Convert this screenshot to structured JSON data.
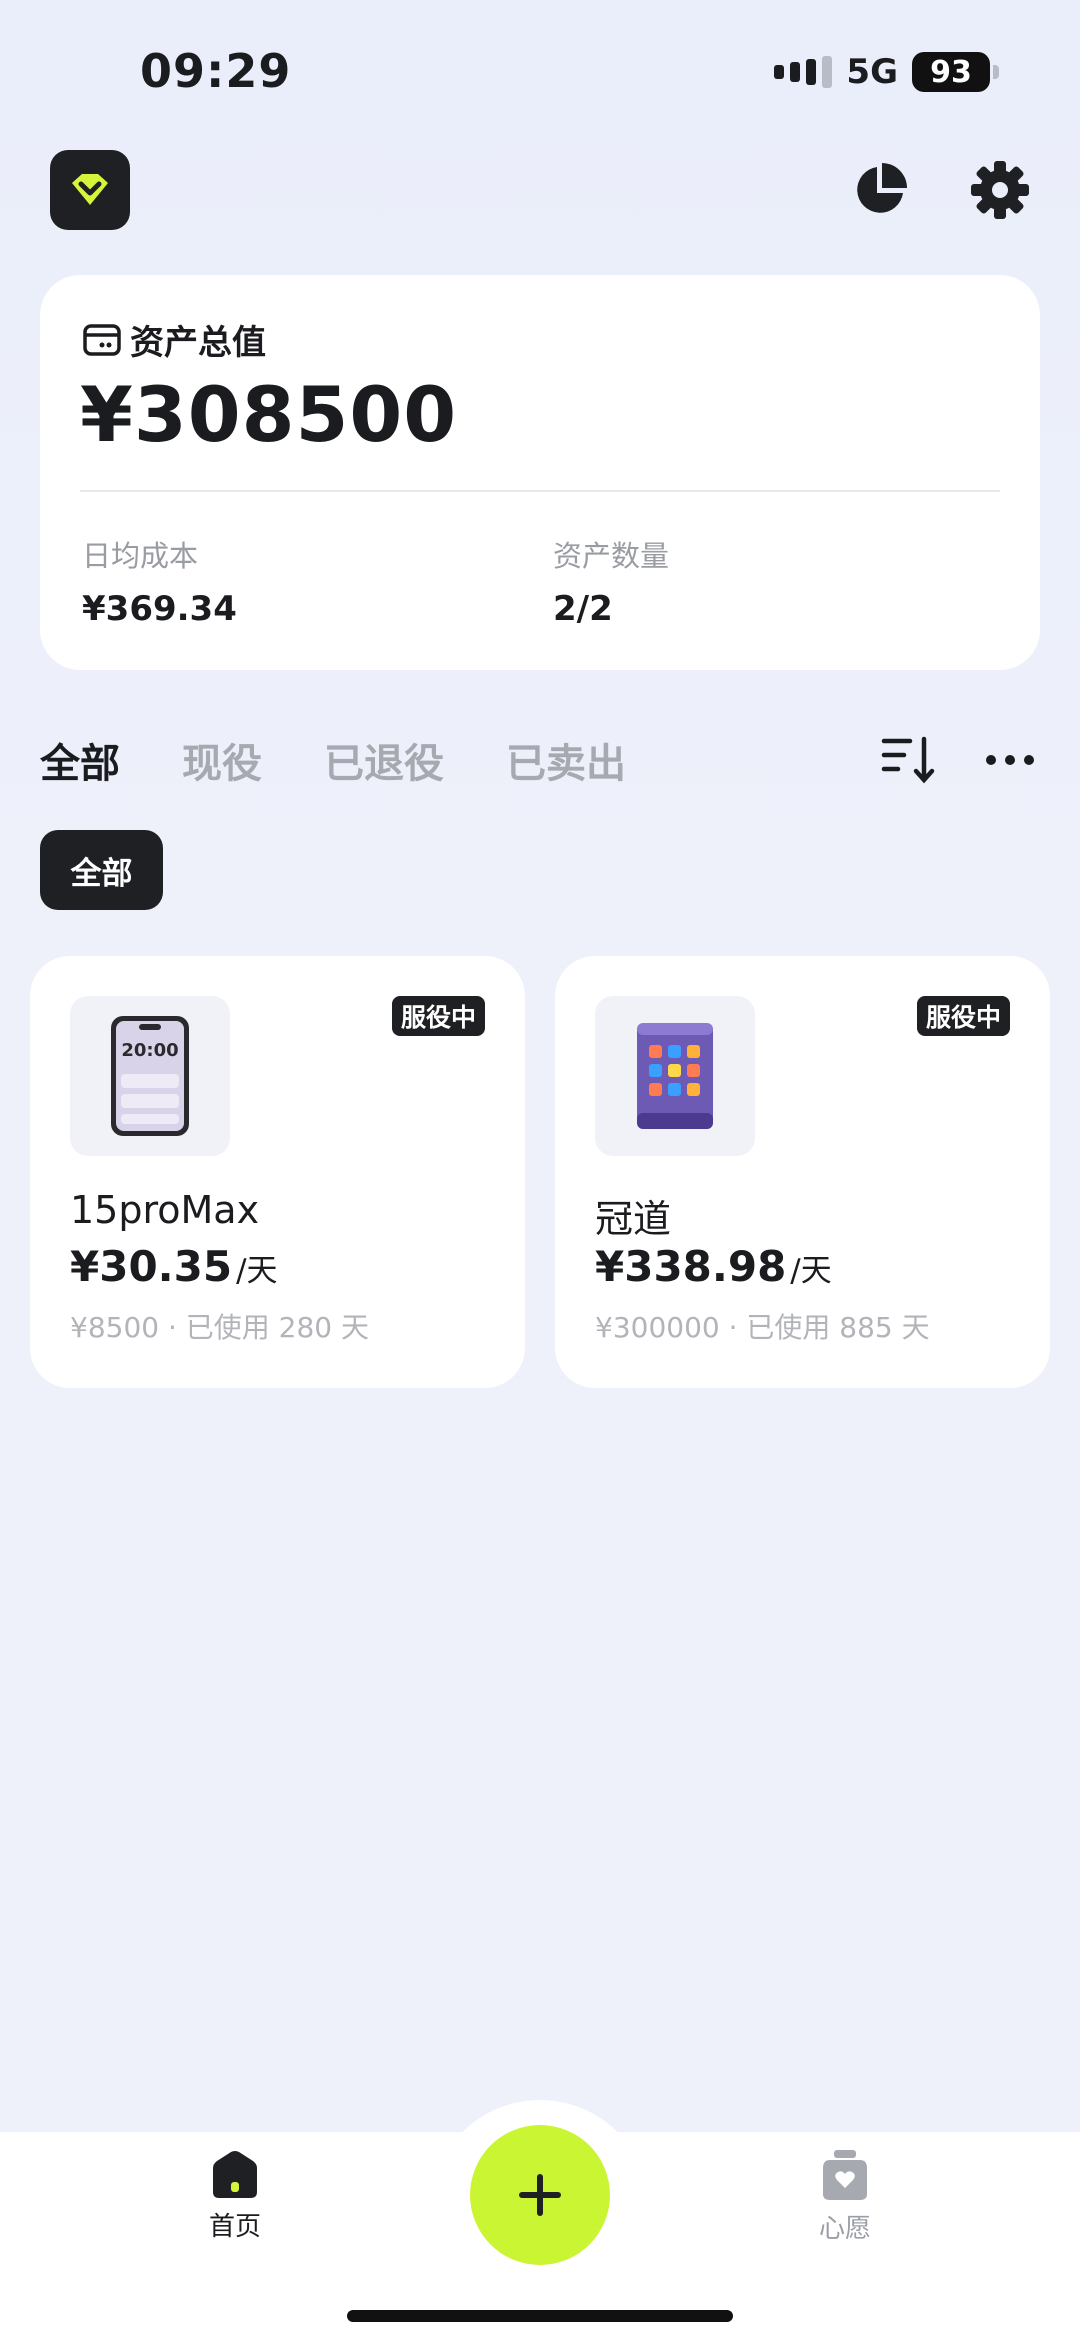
{
  "status_bar": {
    "time": "09:29",
    "network": "5G",
    "battery": "93"
  },
  "header": {
    "logo_icon": "gem-icon",
    "chart_icon": "pie-chart-icon",
    "settings_icon": "gear-icon",
    "accent_color": "#d6f53a"
  },
  "summary": {
    "label": "资产总值",
    "total": "¥308500",
    "daily_cost_label": "日均成本",
    "daily_cost_value": "¥369.34",
    "asset_count_label": "资产数量",
    "asset_count_value": "2/2"
  },
  "tabs": [
    {
      "label": "全部",
      "active": true
    },
    {
      "label": "现役",
      "active": false
    },
    {
      "label": "已退役",
      "active": false
    },
    {
      "label": "已卖出",
      "active": false
    }
  ],
  "filter_chip": "全部",
  "assets": [
    {
      "name": "15proMax",
      "status": "服役中",
      "daily_price": "¥30.35",
      "unit": "/天",
      "meta": "¥8500 · 已使用 280 天",
      "icon": "phone-icon",
      "phone_time": "20:00"
    },
    {
      "name": "冠道",
      "status": "服役中",
      "daily_price": "¥338.98",
      "unit": "/天",
      "meta": "¥300000 · 已使用 885 天",
      "icon": "tablet-icon"
    }
  ],
  "bottom_nav": {
    "home_label": "首页",
    "wish_label": "心愿"
  }
}
